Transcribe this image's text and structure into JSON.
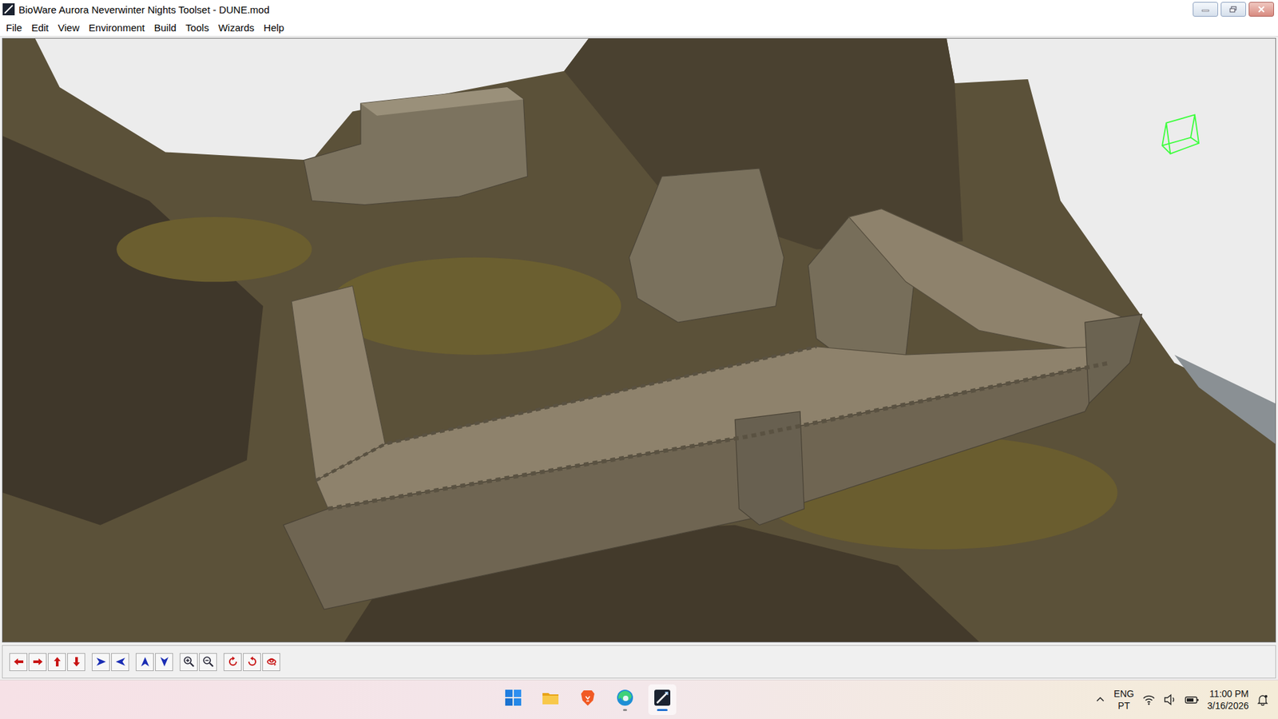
{
  "window": {
    "title": "BioWare Aurora Neverwinter Nights Toolset - DUNE.mod"
  },
  "menu": [
    "File",
    "Edit",
    "View",
    "Environment",
    "Build",
    "Tools",
    "Wizards",
    "Help"
  ],
  "toolbar": [
    [
      {
        "kind": "pan-left"
      },
      {
        "kind": "pan-right"
      },
      {
        "kind": "pan-up"
      },
      {
        "kind": "pan-down"
      }
    ],
    [
      {
        "kind": "move-right"
      },
      {
        "kind": "move-left"
      }
    ],
    [
      {
        "kind": "raise"
      },
      {
        "kind": "lower"
      }
    ],
    [
      {
        "kind": "zoom-in"
      },
      {
        "kind": "zoom-out"
      }
    ],
    [
      {
        "kind": "rotate-cw"
      },
      {
        "kind": "rotate-ccw"
      },
      {
        "kind": "orbit"
      }
    ]
  ],
  "taskbar": {
    "apps": [
      {
        "kind": "start",
        "running": false,
        "selected": false
      },
      {
        "kind": "explorer",
        "running": false,
        "selected": false
      },
      {
        "kind": "brave",
        "running": false,
        "selected": false
      },
      {
        "kind": "edge",
        "running": true,
        "selected": false
      },
      {
        "kind": "toolset",
        "running": true,
        "selected": true
      }
    ],
    "language": {
      "input": "ENG",
      "layout": "PT"
    },
    "clock": {
      "time": "11:00 PM",
      "date": "3/16/2026"
    }
  }
}
